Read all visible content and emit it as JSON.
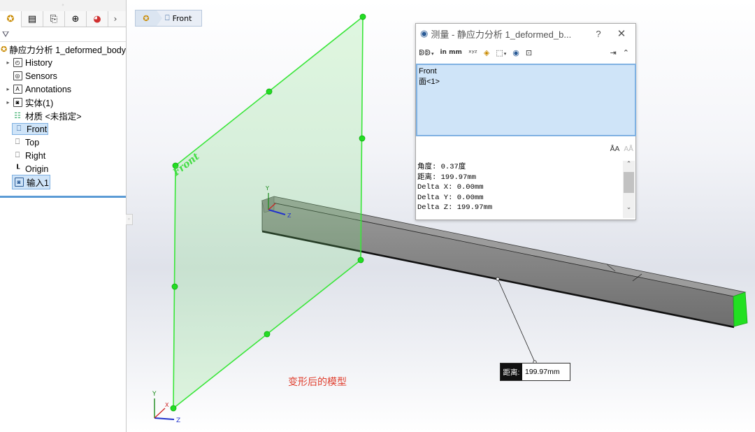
{
  "feature_manager": {
    "tabs": [
      "feature-manager-tab",
      "property-manager-tab",
      "configuration-manager-tab",
      "dimxpert-tab",
      "display-manager-tab"
    ],
    "root": "静应力分析 1_deformed_body",
    "items": [
      {
        "label": "History",
        "expandable": true,
        "icon": "history-folder-icon"
      },
      {
        "label": "Sensors",
        "expandable": false,
        "icon": "sensors-folder-icon"
      },
      {
        "label": "Annotations",
        "expandable": true,
        "icon": "annotations-folder-icon"
      },
      {
        "label": "实体(1)",
        "expandable": true,
        "icon": "solid-bodies-folder-icon"
      },
      {
        "label": "材质 <未指定>",
        "expandable": false,
        "icon": "material-icon"
      },
      {
        "label": "Front",
        "expandable": false,
        "icon": "plane-icon",
        "selected": true
      },
      {
        "label": "Top",
        "expandable": false,
        "icon": "plane-icon"
      },
      {
        "label": "Right",
        "expandable": false,
        "icon": "plane-icon"
      },
      {
        "label": "Origin",
        "expandable": false,
        "icon": "origin-icon"
      },
      {
        "label": "输入1",
        "expandable": false,
        "icon": "imported-body-icon",
        "selected": true
      }
    ]
  },
  "breadcrumb": {
    "item": "Front"
  },
  "measure": {
    "title": "测量 - 静应力分析 1_deformed_b...",
    "help": "?",
    "selection": [
      "Front",
      "面<1>"
    ],
    "results": [
      "角度: 0.37度",
      "距离: 199.97mm",
      "Delta X: 0.00mm",
      "Delta Y: 0.00mm",
      "Delta Z: 199.97mm"
    ],
    "units_button": "in mm"
  },
  "viewport": {
    "plane_label": "Front",
    "triad_axes": [
      "Y",
      "X",
      "Z"
    ],
    "callout": {
      "key": "距离:",
      "value": "199.97mm"
    },
    "caption": "变形后的模型"
  },
  "colors": {
    "plane": "#33ee33",
    "selection": "#cfe4f8",
    "beam": "#8a8a8a",
    "caption": "#e04030"
  }
}
